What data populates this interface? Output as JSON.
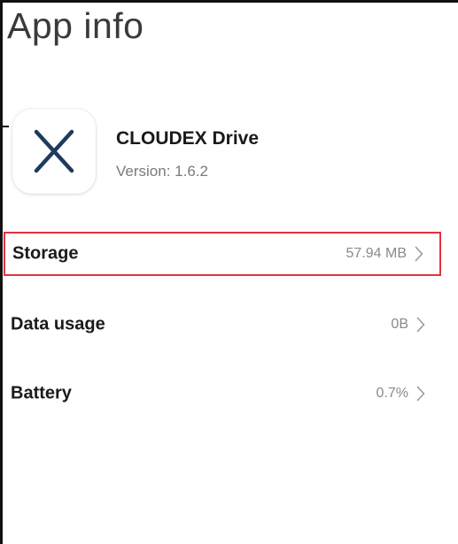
{
  "page": {
    "title": "App info"
  },
  "app": {
    "name": "CLOUDEX Drive",
    "version": "Version: 1.6.2",
    "icon": "cloudex-x-logo-icon",
    "icon_color": "#1f3a5f"
  },
  "rows": [
    {
      "label": "Storage",
      "value": "57.94 MB",
      "highlighted": true
    },
    {
      "label": "Data usage",
      "value": "0B",
      "highlighted": false
    },
    {
      "label": "Battery",
      "value": "0.7%",
      "highlighted": false
    }
  ],
  "colors": {
    "highlight_border": "#e0343e",
    "value_text": "#8a8a8a",
    "chevron": "#9a9a9a"
  }
}
